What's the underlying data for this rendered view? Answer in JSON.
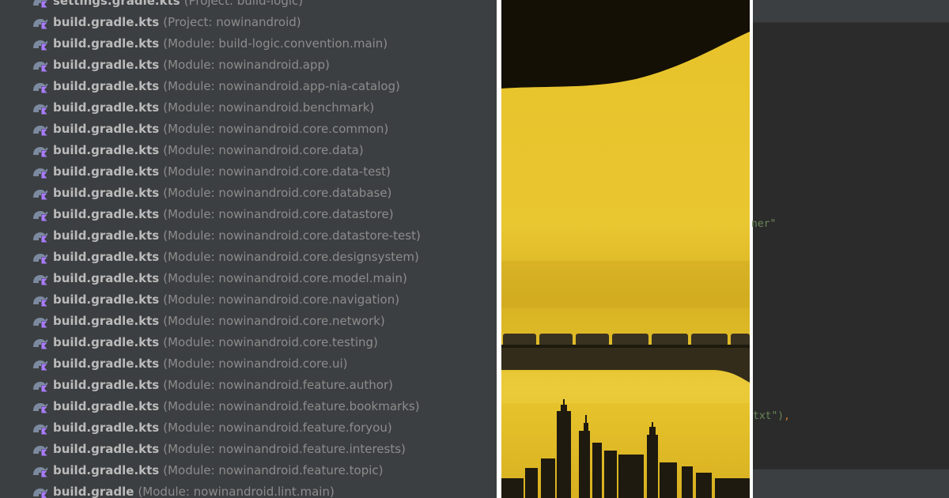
{
  "project_tree": {
    "items": [
      {
        "file": "settings.gradle.kts",
        "module": "(Project: build-logic)"
      },
      {
        "file": "build.gradle.kts",
        "module": "(Project: nowinandroid)"
      },
      {
        "file": "build.gradle.kts",
        "module": "(Module: build-logic.convention.main)"
      },
      {
        "file": "build.gradle.kts",
        "module": "(Module: nowinandroid.app)"
      },
      {
        "file": "build.gradle.kts",
        "module": "(Module: nowinandroid.app-nia-catalog)"
      },
      {
        "file": "build.gradle.kts",
        "module": "(Module: nowinandroid.benchmark)"
      },
      {
        "file": "build.gradle.kts",
        "module": "(Module: nowinandroid.core.common)"
      },
      {
        "file": "build.gradle.kts",
        "module": "(Module: nowinandroid.core.data)"
      },
      {
        "file": "build.gradle.kts",
        "module": "(Module: nowinandroid.core.data-test)"
      },
      {
        "file": "build.gradle.kts",
        "module": "(Module: nowinandroid.core.database)"
      },
      {
        "file": "build.gradle.kts",
        "module": "(Module: nowinandroid.core.datastore)"
      },
      {
        "file": "build.gradle.kts",
        "module": "(Module: nowinandroid.core.datastore-test)"
      },
      {
        "file": "build.gradle.kts",
        "module": "(Module: nowinandroid.core.designsystem)"
      },
      {
        "file": "build.gradle.kts",
        "module": "(Module: nowinandroid.core.model.main)"
      },
      {
        "file": "build.gradle.kts",
        "module": "(Module: nowinandroid.core.navigation)"
      },
      {
        "file": "build.gradle.kts",
        "module": "(Module: nowinandroid.core.network)"
      },
      {
        "file": "build.gradle.kts",
        "module": "(Module: nowinandroid.core.testing)"
      },
      {
        "file": "build.gradle.kts",
        "module": "(Module: nowinandroid.core.ui)"
      },
      {
        "file": "build.gradle.kts",
        "module": "(Module: nowinandroid.feature.author)"
      },
      {
        "file": "build.gradle.kts",
        "module": "(Module: nowinandroid.feature.bookmarks)"
      },
      {
        "file": "build.gradle.kts",
        "module": "(Module: nowinandroid.feature.foryou)"
      },
      {
        "file": "build.gradle.kts",
        "module": "(Module: nowinandroid.feature.interests)"
      },
      {
        "file": "build.gradle.kts",
        "module": "(Module: nowinandroid.feature.topic)"
      },
      {
        "file": "build.gradle",
        "module": "(Module: nowinandroid.lint.main)"
      }
    ],
    "icon": "gradle-kotlin-icon"
  },
  "editor": {
    "fragments": [
      {
        "string": "ner\"",
        "punct": ""
      },
      {
        "string": "txt\")",
        "punct": ","
      }
    ]
  },
  "colors": {
    "tree_bg": "#3c3f41",
    "editor_bg": "#2b2b2b",
    "string_green": "#6a8759",
    "photo_yellow": "#e8c22a"
  }
}
